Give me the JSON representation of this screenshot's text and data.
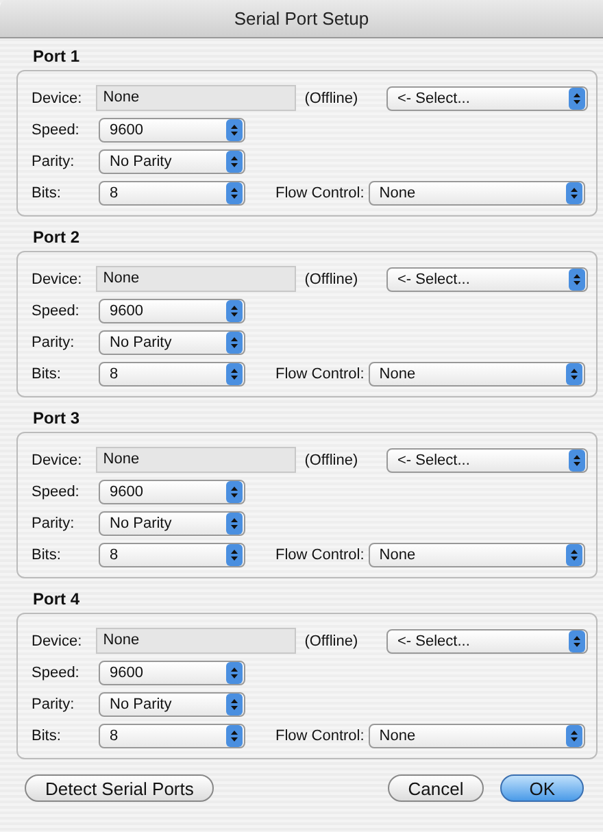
{
  "window": {
    "title": "Serial Port Setup"
  },
  "ports": [
    {
      "title": "Port 1",
      "device_label": "Device:",
      "device": "None",
      "status": "(Offline)",
      "select": "<- Select...",
      "speed_label": "Speed:",
      "speed": "9600",
      "parity_label": "Parity:",
      "parity": "No Parity",
      "bits_label": "Bits:",
      "bits": "8",
      "flow_label": "Flow Control:",
      "flow": "None"
    },
    {
      "title": "Port 2",
      "device_label": "Device:",
      "device": "None",
      "status": "(Offline)",
      "select": "<- Select...",
      "speed_label": "Speed:",
      "speed": "9600",
      "parity_label": "Parity:",
      "parity": "No Parity",
      "bits_label": "Bits:",
      "bits": "8",
      "flow_label": "Flow Control:",
      "flow": "None"
    },
    {
      "title": "Port 3",
      "device_label": "Device:",
      "device": "None",
      "status": "(Offline)",
      "select": "<- Select...",
      "speed_label": "Speed:",
      "speed": "9600",
      "parity_label": "Parity:",
      "parity": "No Parity",
      "bits_label": "Bits:",
      "bits": "8",
      "flow_label": "Flow Control:",
      "flow": "None"
    },
    {
      "title": "Port 4",
      "device_label": "Device:",
      "device": "None",
      "status": "(Offline)",
      "select": "<- Select...",
      "speed_label": "Speed:",
      "speed": "9600",
      "parity_label": "Parity:",
      "parity": "No Parity",
      "bits_label": "Bits:",
      "bits": "8",
      "flow_label": "Flow Control:",
      "flow": "None"
    }
  ],
  "buttons": [
    {
      "label": "Detect Serial Ports",
      "default": false
    },
    {
      "label": "Cancel",
      "default": false
    },
    {
      "label": "OK",
      "default": true
    }
  ]
}
